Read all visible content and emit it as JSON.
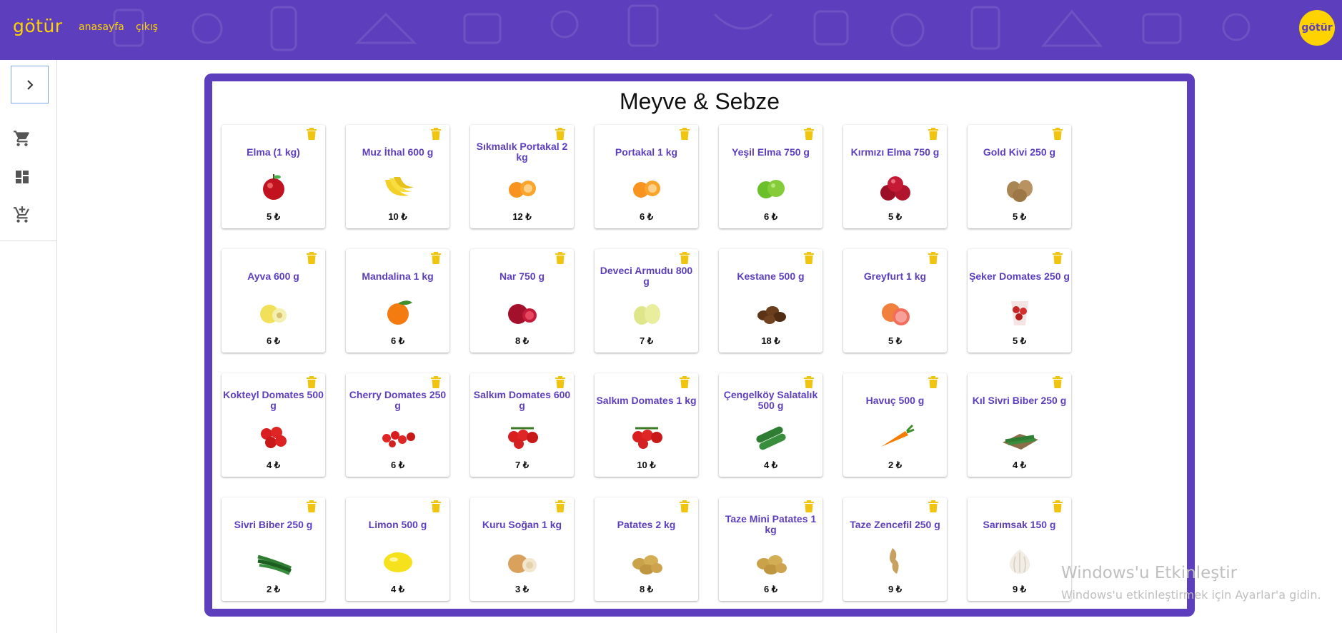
{
  "header": {
    "brand": "götür",
    "nav": [
      "anasayfa",
      "çıkış"
    ],
    "avatar_text": "götür"
  },
  "colors": {
    "primary": "#5d3ebc",
    "accent": "#ffd300"
  },
  "sidebar": {
    "toggle_icon": "chevron-right-icon",
    "items": [
      {
        "icon": "cart-icon"
      },
      {
        "icon": "dashboard-icon"
      },
      {
        "icon": "add-to-cart-icon"
      }
    ]
  },
  "main": {
    "title": "Meyve & Sebze",
    "products": [
      {
        "name": "Elma (1 kg)",
        "price": "5 ₺",
        "icon": "apple"
      },
      {
        "name": "Muz İthal 600 g",
        "price": "10 ₺",
        "icon": "banana"
      },
      {
        "name": "Sıkmalık Portakal 2 kg",
        "price": "12 ₺",
        "icon": "oranges"
      },
      {
        "name": "Portakal 1 kg",
        "price": "6 ₺",
        "icon": "oranges"
      },
      {
        "name": "Yeşil Elma 750 g",
        "price": "6 ₺",
        "icon": "green-apple"
      },
      {
        "name": "Kırmızı Elma 750 g",
        "price": "5 ₺",
        "icon": "red-apples"
      },
      {
        "name": "Gold Kivi 250 g",
        "price": "5 ₺",
        "icon": "kiwi"
      },
      {
        "name": "Ayva 600 g",
        "price": "6 ₺",
        "icon": "quince"
      },
      {
        "name": "Mandalina 1 kg",
        "price": "6 ₺",
        "icon": "mandarin"
      },
      {
        "name": "Nar 750 g",
        "price": "8 ₺",
        "icon": "pomegranate"
      },
      {
        "name": "Deveci Armudu 800 g",
        "price": "7 ₺",
        "icon": "pear"
      },
      {
        "name": "Kestane 500 g",
        "price": "18 ₺",
        "icon": "chestnut"
      },
      {
        "name": "Greyfurt 1 kg",
        "price": "5 ₺",
        "icon": "grapefruit"
      },
      {
        "name": "Şeker Domates 250 g",
        "price": "5 ₺",
        "icon": "cherry-cup"
      },
      {
        "name": "Kokteyl Domates 500 g",
        "price": "4 ₺",
        "icon": "tomatoes"
      },
      {
        "name": "Cherry Domates 250 g",
        "price": "6 ₺",
        "icon": "cherry-tomatoes"
      },
      {
        "name": "Salkım Domates 600 g",
        "price": "7 ₺",
        "icon": "vine-tomatoes"
      },
      {
        "name": "Salkım Domates 1 kg",
        "price": "10 ₺",
        "icon": "vine-tomatoes"
      },
      {
        "name": "Çengelköy Salatalık 500 g",
        "price": "4 ₺",
        "icon": "cucumber"
      },
      {
        "name": "Havuç 500 g",
        "price": "2 ₺",
        "icon": "carrot"
      },
      {
        "name": "Kıl Sivri Biber 250 g",
        "price": "4 ₺",
        "icon": "pepper-box"
      },
      {
        "name": "Sivri Biber 250 g",
        "price": "2 ₺",
        "icon": "green-peppers"
      },
      {
        "name": "Limon 500 g",
        "price": "4 ₺",
        "icon": "lemon"
      },
      {
        "name": "Kuru Soğan 1 kg",
        "price": "3 ₺",
        "icon": "onion"
      },
      {
        "name": "Patates 2 kg",
        "price": "8 ₺",
        "icon": "potatoes"
      },
      {
        "name": "Taze Mini Patates 1 kg",
        "price": "6 ₺",
        "icon": "potatoes"
      },
      {
        "name": "Taze Zencefil 250 g",
        "price": "9 ₺",
        "icon": "ginger"
      },
      {
        "name": "Sarımsak 150 g",
        "price": "9 ₺",
        "icon": "garlic"
      }
    ]
  },
  "watermark": {
    "line1": "Windows'u Etkinleştir",
    "line2": "Windows'u etkinleştirmek için Ayarlar'a gidin."
  }
}
